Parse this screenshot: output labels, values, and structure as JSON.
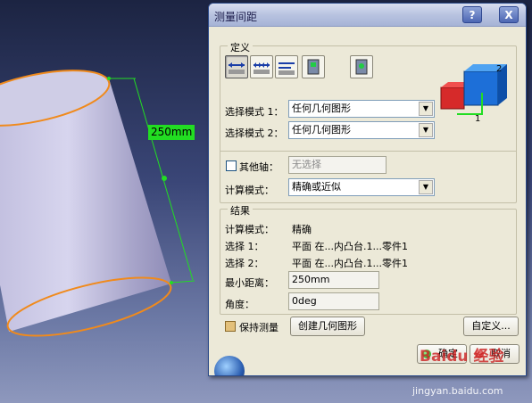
{
  "viewport": {
    "dimension_text": "250mm"
  },
  "dialog": {
    "title": "测量间距",
    "help_label": "?",
    "close_label": "X",
    "definition": {
      "legend": "定义",
      "selection_mode_1_label": "选择模式 1：",
      "selection_mode_1_value": "任何几何图形",
      "selection_mode_2_label": "选择模式 2：",
      "selection_mode_2_value": "任何几何图形",
      "other_axis_label": "其他轴：",
      "other_axis_value": "无选择",
      "calc_mode_label": "计算模式：",
      "calc_mode_value": "精确或近似"
    },
    "results": {
      "legend": "结果",
      "calc_mode_label": "计算模式：",
      "calc_mode_value": "精确",
      "selection_1_label": "选择 1：",
      "selection_1_value": "平面 在...内凸台.1...零件1",
      "selection_2_label": "选择 2：",
      "selection_2_value": "平面 在...内凸台.1...零件1",
      "min_distance_label": "最小距离：",
      "min_distance_value": "250mm",
      "angle_label": "角度：",
      "angle_value": "0deg"
    },
    "keep_measure_label": "保持测量",
    "create_geometry_label": "创建几何图形",
    "customize_label": "自定义...",
    "ok_label": "确定",
    "cancel_label": "取消"
  },
  "watermark": {
    "brand": "Baidu 经验",
    "url": "jingyan.baidu.com"
  }
}
